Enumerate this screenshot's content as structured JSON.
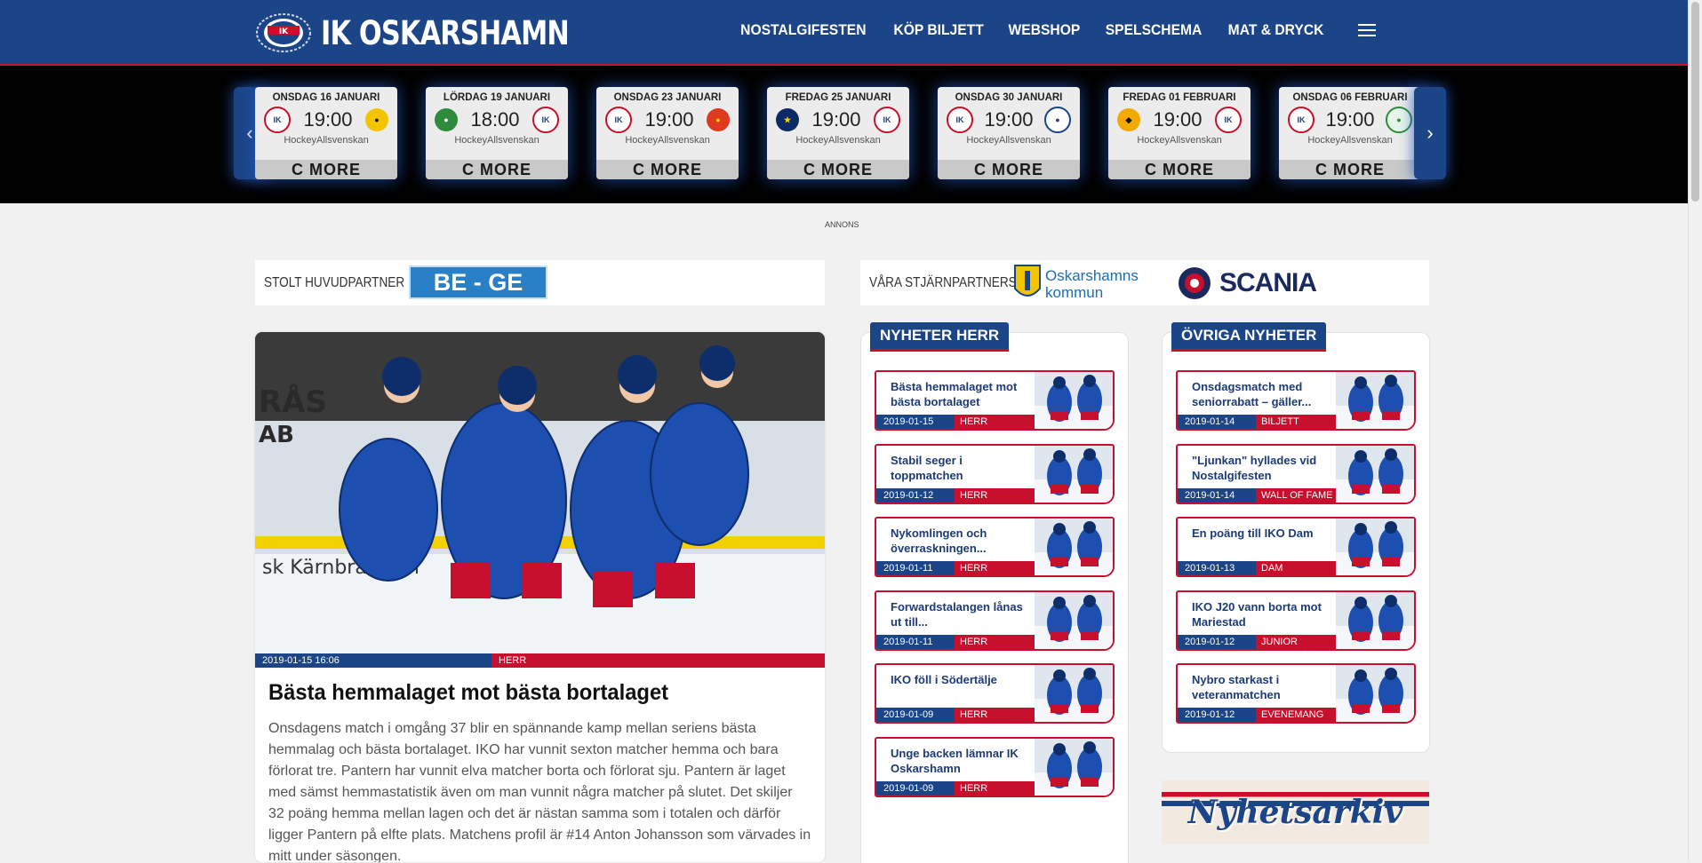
{
  "header": {
    "logo_text": "IK OSKARSHAMN",
    "nav": [
      "NOSTALGIFESTEN",
      "KÖP BILJETT",
      "WEBSHOP",
      "SPELSCHEMA",
      "MAT & DRYCK"
    ]
  },
  "fixtures": [
    {
      "date": "ONSDAG 16 JANUARI",
      "time": "19:00",
      "league": "HockeyAllsvenskan",
      "more": "MORE"
    },
    {
      "date": "LÖRDAG 19 JANUARI",
      "time": "18:00",
      "league": "HockeyAllsvenskan",
      "more": "MORE"
    },
    {
      "date": "ONSDAG 23 JANUARI",
      "time": "19:00",
      "league": "HockeyAllsvenskan",
      "more": "MORE"
    },
    {
      "date": "FREDAG 25 JANUARI",
      "time": "19:00",
      "league": "HockeyAllsvenskan",
      "more": "MORE"
    },
    {
      "date": "ONSDAG 30 JANUARI",
      "time": "19:00",
      "league": "HockeyAllsvenskan",
      "more": "MORE"
    },
    {
      "date": "FREDAG 01 FEBRUARI",
      "time": "19:00",
      "league": "HockeyAllsvenskan",
      "more": "MORE"
    },
    {
      "date": "ONSDAG 06 FEBRUARI",
      "time": "19:00",
      "league": "HockeyAllsvenskan",
      "more": "MORE"
    }
  ],
  "annons": "ANNONS",
  "partners": {
    "main_label": "STOLT HUVUDPARTNER",
    "main_logo": "BE - GE",
    "star_label": "VÅRA STJÄRNPARTNERS",
    "star_logo1_line1": "Oskarshamns",
    "star_logo1_line2": "kommun",
    "star_logo2": "SCANIA"
  },
  "main_article": {
    "date": "2019-01-15 16:06",
    "category": "HERR",
    "title": "Bästa hemmalaget mot bästa bortalaget",
    "body": "Onsdagens match i omgång 37 blir en spännande kamp mellan seriens bästa hemmalag och bästa bortalaget. IKO har vunnit sexton matcher hemma och bara förlorat tre. Pantern har vunnit elva matcher borta och förlorat sju. Pantern är laget med sämst hemmastatistik även om man vunnit några matcher på slutet. Det skiljer 32 poäng hemma mellan lagen och det är nästan samma som i totalen och därför ligger Pantern på elfte plats. Matchens profil är #14 Anton Johansson som värvades in mitt under säsongen."
  },
  "news_herr": {
    "heading": "NYHETER HERR",
    "items": [
      {
        "title": "Bästa hemmalaget mot bästa bortalaget",
        "date": "2019-01-15",
        "cat": "HERR"
      },
      {
        "title": "Stabil seger i toppmatchen",
        "date": "2019-01-12",
        "cat": "HERR"
      },
      {
        "title": "Nykomlingen och överraskningen...",
        "date": "2019-01-11",
        "cat": "HERR"
      },
      {
        "title": "Forwardstalangen lånas ut till...",
        "date": "2019-01-11",
        "cat": "HERR"
      },
      {
        "title": "IKO föll i Södertälje",
        "date": "2019-01-09",
        "cat": "HERR"
      },
      {
        "title": "Unge backen lämnar IK Oskarshamn",
        "date": "2019-01-09",
        "cat": "HERR"
      }
    ]
  },
  "news_other": {
    "heading": "ÖVRIGA NYHETER",
    "items": [
      {
        "title": "Onsdagsmatch med seniorrabatt – gäller...",
        "date": "2019-01-14",
        "cat": "BILJETT"
      },
      {
        "title": "\"Ljunkan\" hyllades vid Nostalgifesten",
        "date": "2019-01-14",
        "cat": "WALL OF FAME"
      },
      {
        "title": "En poäng till IKO Dam",
        "date": "2019-01-13",
        "cat": "DAM"
      },
      {
        "title": "IKO J20 vann borta mot Mariestad",
        "date": "2019-01-12",
        "cat": "JUNIOR"
      },
      {
        "title": "Nybro starkast i veteranmatchen",
        "date": "2019-01-12",
        "cat": "EVENEMANG"
      }
    ]
  },
  "archive_label": "Nyhetsarkiv",
  "colors": {
    "brand_blue": "#1c4587",
    "brand_red": "#c8102e"
  }
}
